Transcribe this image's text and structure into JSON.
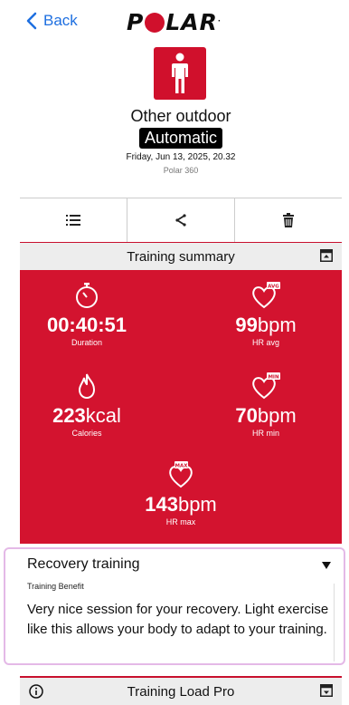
{
  "nav": {
    "back_label": "Back",
    "logo_text_left": "P",
    "logo_text_right": "LAR",
    "logo_mark": "."
  },
  "session": {
    "sport": "Other outdoor",
    "tag": "Automatic",
    "date": "Friday, Jun 13, 2025, 20.32",
    "device": "Polar 360"
  },
  "actions": [
    {
      "icon": "list-icon"
    },
    {
      "icon": "share-icon"
    },
    {
      "icon": "trash-icon"
    }
  ],
  "summary": {
    "title": "Training summary",
    "metrics": [
      {
        "value": "00:40:51",
        "unit": "",
        "label": "Duration",
        "icon": "stopwatch-icon"
      },
      {
        "value": "99",
        "unit": "bpm",
        "label": "HR avg",
        "icon": "heart-avg-icon",
        "badge": "AVG"
      },
      {
        "value": "223",
        "unit": "kcal",
        "label": "Calories",
        "icon": "flame-icon"
      },
      {
        "value": "70",
        "unit": "bpm",
        "label": "HR min",
        "icon": "heart-min-icon",
        "badge": "MIN"
      },
      {
        "value": "143",
        "unit": "bpm",
        "label": "HR max",
        "icon": "heart-max-icon",
        "badge": "MAX"
      }
    ]
  },
  "recovery": {
    "title": "Recovery training",
    "subtitle": "Training Benefit",
    "text": "Very nice session for your recovery. Light exercise like this allows your body to adapt to your training."
  },
  "training_load": {
    "title": "Training Load Pro"
  },
  "colors": {
    "brand_red": "#d3132f",
    "link_blue": "#1e6fe0",
    "highlight": "#e4b9e7"
  }
}
